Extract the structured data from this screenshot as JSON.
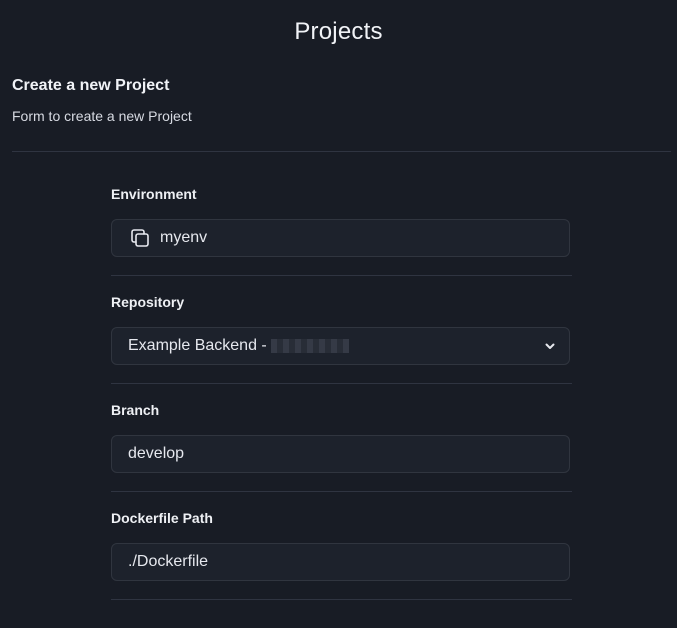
{
  "page": {
    "title": "Projects"
  },
  "section": {
    "title": "Create a new Project",
    "description": "Form to create a new Project"
  },
  "form": {
    "environment": {
      "label": "Environment",
      "value": "myenv",
      "icon": "copy-icon"
    },
    "repository": {
      "label": "Repository",
      "value": "Example Backend -",
      "icon": "chevron-down-icon"
    },
    "branch": {
      "label": "Branch",
      "value": "develop"
    },
    "dockerfile": {
      "label": "Dockerfile Path",
      "value": "./Dockerfile"
    }
  },
  "colors": {
    "background": "#181c25",
    "input_background": "#1d222c",
    "border": "#30353f",
    "text": "#e6e8ee"
  }
}
